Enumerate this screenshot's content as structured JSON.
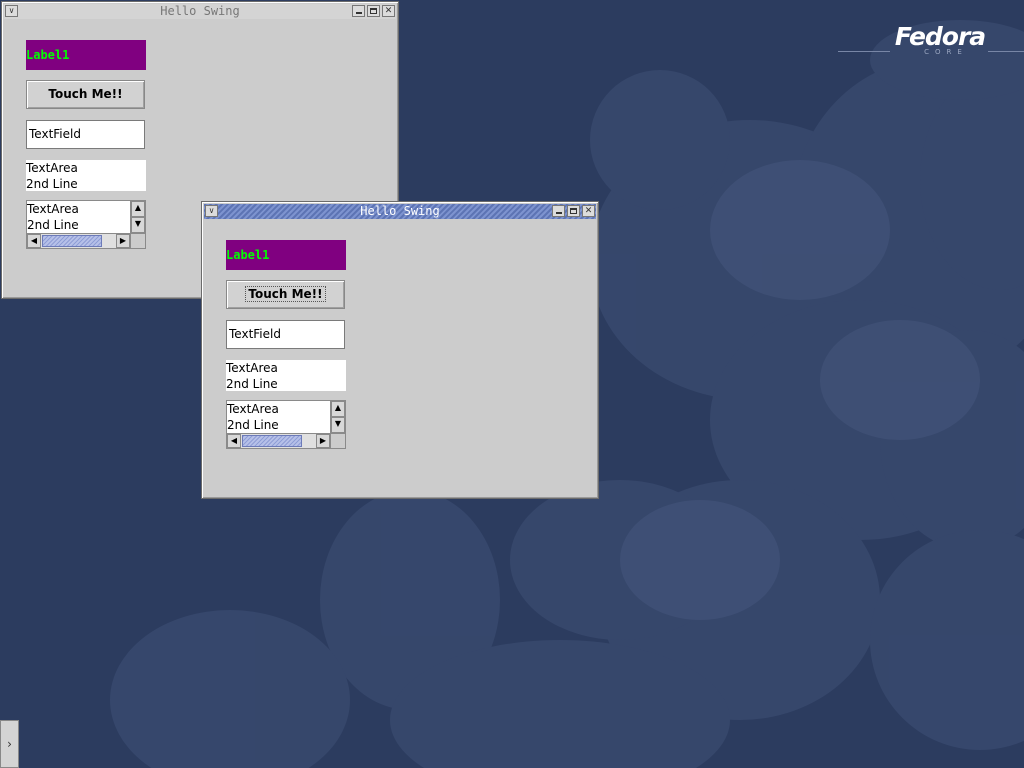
{
  "desktop": {
    "logo": {
      "brand": "Fedora",
      "sub": "CORE"
    },
    "background_color": "#2c3c5f"
  },
  "windows": [
    {
      "title": "Hello Swing",
      "state": "inactive",
      "label": "Label1",
      "button": "Touch Me!!",
      "textfield": "TextField",
      "textarea_lines": [
        "TextArea",
        "2nd Line"
      ],
      "scroll_textarea_lines": [
        "TextArea",
        "2nd Line"
      ]
    },
    {
      "title": "Hello Swing",
      "state": "active",
      "label": "Label1",
      "button": "Touch Me!!",
      "textfield": "TextField",
      "textarea_lines": [
        "TextArea",
        "2nd Line"
      ],
      "scroll_textarea_lines": [
        "TextArea",
        "2nd Line"
      ]
    }
  ],
  "icons": {
    "window_menu": "chevron-down-icon",
    "minimize": "minimize-icon",
    "maximize": "maximize-icon",
    "close": "close-icon",
    "scroll_up": "arrow-up-icon",
    "scroll_down": "arrow-down-icon",
    "scroll_left": "arrow-left-icon",
    "scroll_right": "arrow-right-icon",
    "panel_toggle": "chevron-right-icon"
  },
  "colors": {
    "label_bg": "#800080",
    "label_fg": "#00ff00",
    "window_bg": "#cccccc",
    "active_title": "#5d74b4"
  }
}
